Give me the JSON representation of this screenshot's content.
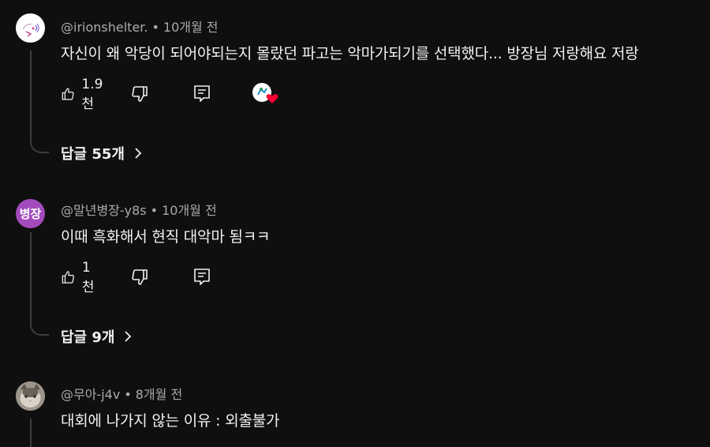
{
  "comments": [
    {
      "author": "@irionshelter.",
      "time": "10개월 전",
      "text": "자신이 왜 악당이 되어야되는지 몰랐던 파고는 악마가되기를 선택했다... 방장님 저랑해요 저랑",
      "likes": "1.9천",
      "replies": "답글 55개",
      "avatar_icon": "hand-drawn-face-icon"
    },
    {
      "author": "@말년병장-y8s",
      "time": "10개월 전",
      "text": "이때 흑화해서 현직 대악마 됨ㅋㅋ",
      "likes": "1천",
      "replies": "답글 9개",
      "avatar_text": "병장",
      "avatar_color": "#a34bbd"
    },
    {
      "author": "@무아-j4v",
      "time": "8개월 전",
      "text": "대회에 나가지 않는 이유 : 외출불가",
      "avatar_icon": "cat-photo-icon"
    }
  ],
  "colors": {
    "background": "#0f0f0f",
    "text": "#f1f1f1",
    "meta": "#aaaaaa",
    "heart": "#ff0033"
  }
}
